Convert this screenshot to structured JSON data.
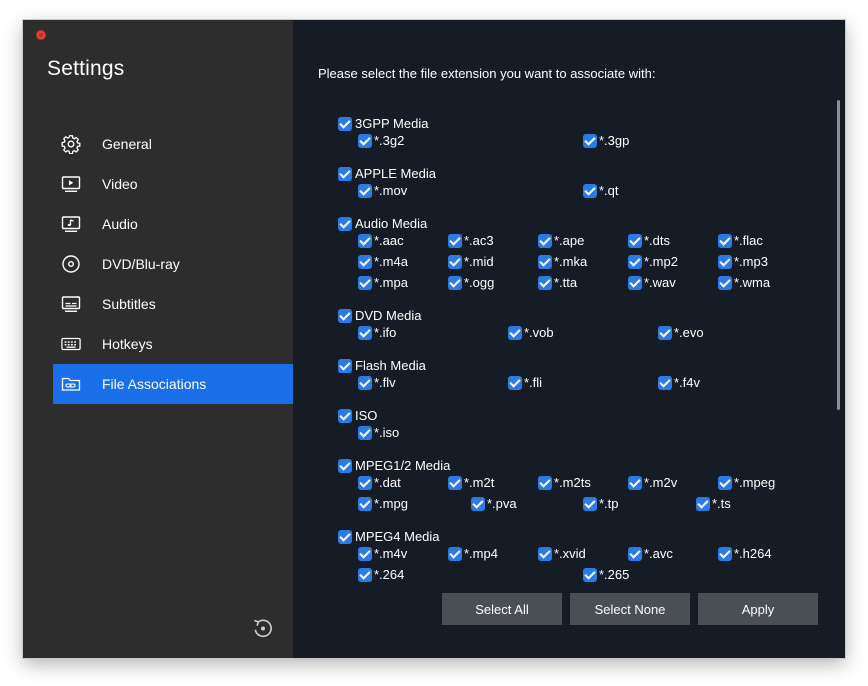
{
  "window": {
    "close_button": "close"
  },
  "sidebar": {
    "title": "Settings",
    "items": [
      {
        "label": "General",
        "icon": "gear-icon",
        "active": false
      },
      {
        "label": "Video",
        "icon": "video-icon",
        "active": false
      },
      {
        "label": "Audio",
        "icon": "audio-icon",
        "active": false
      },
      {
        "label": "DVD/Blu-ray",
        "icon": "disc-icon",
        "active": false
      },
      {
        "label": "Subtitles",
        "icon": "subtitles-icon",
        "active": false
      },
      {
        "label": "Hotkeys",
        "icon": "keyboard-icon",
        "active": false
      },
      {
        "label": "File Associations",
        "icon": "folder-link-icon",
        "active": true
      }
    ],
    "reset_icon": "reset-icon"
  },
  "main": {
    "prompt": "Please select the file extension you want to associate with:",
    "categories": [
      {
        "name": "3GPP Media",
        "checked": true,
        "extensions": [
          "*.3g2",
          "*.3gp"
        ]
      },
      {
        "name": "APPLE Media",
        "checked": true,
        "extensions": [
          "*.mov",
          "*.qt"
        ]
      },
      {
        "name": "Audio Media",
        "checked": true,
        "extensions": [
          "*.aac",
          "*.ac3",
          "*.ape",
          "*.dts",
          "*.flac",
          "*.m4a",
          "*.mid",
          "*.mka",
          "*.mp2",
          "*.mp3",
          "*.mpa",
          "*.ogg",
          "*.tta",
          "*.wav",
          "*.wma"
        ]
      },
      {
        "name": "DVD Media",
        "checked": true,
        "extensions": [
          "*.ifo",
          "*.vob",
          "*.evo"
        ]
      },
      {
        "name": "Flash Media",
        "checked": true,
        "extensions": [
          "*.flv",
          "*.fli",
          "*.f4v"
        ]
      },
      {
        "name": "ISO",
        "checked": true,
        "extensions": [
          "*.iso"
        ]
      },
      {
        "name": "MPEG1/2 Media",
        "checked": true,
        "extensions": [
          "*.dat",
          "*.m2t",
          "*.m2ts",
          "*.m2v",
          "*.mpeg",
          "*.mpg",
          "*.pva",
          "*.tp",
          "*.ts"
        ]
      },
      {
        "name": "MPEG4 Media",
        "checked": true,
        "extensions": [
          "*.m4v",
          "*.mp4",
          "*.xvid",
          "*.avc",
          "*.h264",
          "*.264",
          "*.265"
        ]
      }
    ],
    "buttons": {
      "select_all": "Select All",
      "select_none": "Select None",
      "apply": "Apply"
    }
  },
  "colors": {
    "accent": "#1a6fe8",
    "checkbox": "#2c7be5",
    "sidebar_bg": "#2d2d2d",
    "main_bg": "#161c26",
    "button_bg": "#4a4e55"
  }
}
